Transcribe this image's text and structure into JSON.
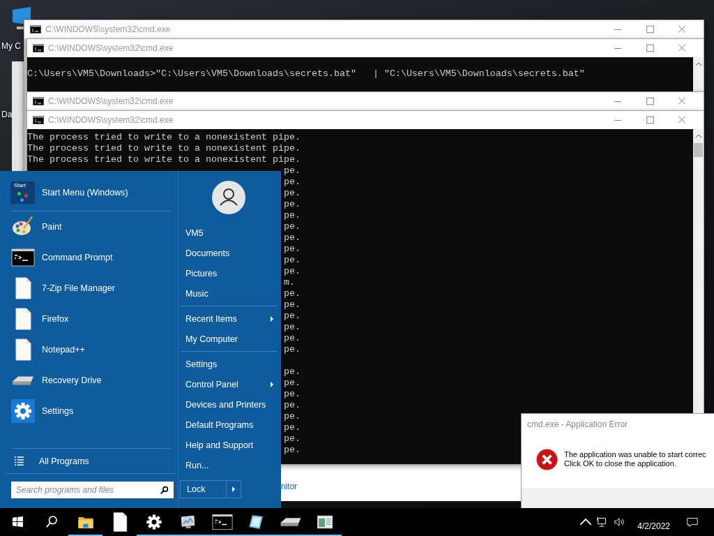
{
  "desktop": {
    "icons": [
      {
        "label": "My C"
      },
      {
        "label": "Da"
      }
    ]
  },
  "windows": [
    {
      "title": "C:\\WINDOWS\\system32\\cmd.exe",
      "active": false
    },
    {
      "title": "C:\\WINDOWS\\system32\\cmd.exe",
      "active": false,
      "console": [
        {
          "kind": "full",
          "text": "C:\\Users\\VM5\\Downloads>\"C:\\Users\\VM5\\Downloads\\secrets.bat\"   | \"C:\\Users\\VM5\\Downloads\\secrets.bat\""
        }
      ]
    },
    {
      "title": "C:\\WINDOWS\\system32\\cmd.exe",
      "active": false
    },
    {
      "title": "C:\\WINDOWS\\system32\\cmd.exe",
      "active": false,
      "console": [
        {
          "kind": "full",
          "text": "The process tried to write to a nonexistent pipe."
        },
        {
          "kind": "full",
          "text": "The process tried to write to a nonexistent pipe."
        },
        {
          "kind": "full",
          "text": "The process tried to write to a nonexistent pipe."
        },
        {
          "kind": "tail",
          "text": "pe."
        },
        {
          "kind": "tail",
          "text": "pe."
        },
        {
          "kind": "tail",
          "text": "pe."
        },
        {
          "kind": "tail",
          "text": "pe."
        },
        {
          "kind": "tail",
          "text": "pe."
        },
        {
          "kind": "tail",
          "text": "pe."
        },
        {
          "kind": "tail",
          "text": "pe."
        },
        {
          "kind": "tail",
          "text": "pe."
        },
        {
          "kind": "tail",
          "text": "pe."
        },
        {
          "kind": "tail",
          "text": "pe."
        },
        {
          "kind": "tail",
          "text": "m."
        },
        {
          "kind": "tail",
          "text": "pe."
        },
        {
          "kind": "tail",
          "text": "pe."
        },
        {
          "kind": "tail",
          "text": "pe."
        },
        {
          "kind": "tail",
          "text": "pe."
        },
        {
          "kind": "tail",
          "text": "pe."
        },
        {
          "kind": "tail",
          "text": "pe."
        },
        {
          "kind": "blank"
        },
        {
          "kind": "tail",
          "text": "pe."
        },
        {
          "kind": "tail",
          "text": "pe."
        },
        {
          "kind": "tail",
          "text": "pe."
        },
        {
          "kind": "tail",
          "text": "pe."
        },
        {
          "kind": "tail",
          "text": "pe."
        },
        {
          "kind": "tail",
          "text": "pe."
        },
        {
          "kind": "tail",
          "text": "pe."
        },
        {
          "kind": "tail",
          "text": "pe."
        }
      ]
    }
  ],
  "background_window": {
    "link": "nitor"
  },
  "start_menu": {
    "header": {
      "logo_text": "Start",
      "label": "Start Menu (Windows)"
    },
    "programs": [
      {
        "label": "Paint",
        "kind": "paint"
      },
      {
        "label": "Command Prompt",
        "kind": "terminal"
      },
      {
        "label": "7-Zip File Manager",
        "kind": "file"
      },
      {
        "label": "Firefox",
        "kind": "file"
      },
      {
        "label": "Notepad++",
        "kind": "file"
      },
      {
        "label": "Recovery Drive",
        "kind": "drive"
      },
      {
        "label": "Settings",
        "kind": "gear"
      }
    ],
    "all_programs": "All Programs",
    "search": {
      "placeholder": "Search programs and files"
    },
    "places": [
      {
        "items": [
          {
            "label": "VM5",
            "submenu": false
          },
          {
            "label": "Documents",
            "submenu": false
          },
          {
            "label": "Pictures",
            "submenu": false
          },
          {
            "label": "Music",
            "submenu": false
          }
        ]
      },
      {
        "items": [
          {
            "label": "Recent Items",
            "submenu": true
          },
          {
            "label": "My Computer",
            "submenu": false
          }
        ]
      },
      {
        "items": [
          {
            "label": "Settings",
            "submenu": false
          },
          {
            "label": "Control Panel",
            "submenu": true
          },
          {
            "label": "Devices and Printers",
            "submenu": false
          },
          {
            "label": "Default Programs",
            "submenu": false
          },
          {
            "label": "Help and Support",
            "submenu": false
          },
          {
            "label": "Run...",
            "submenu": false
          }
        ]
      }
    ],
    "lock": "Lock"
  },
  "error_dialog": {
    "title": "cmd.exe - Application Error",
    "message": [
      "The application was unable to start correc",
      "Click OK to close the application."
    ]
  },
  "taskbar": {
    "items": [
      {
        "kind": "start",
        "running": false
      },
      {
        "kind": "search",
        "running": false
      },
      {
        "kind": "folder",
        "running": true
      },
      {
        "kind": "file",
        "running": false
      },
      {
        "kind": "gear",
        "running": true
      },
      {
        "kind": "monitor",
        "running": true
      },
      {
        "kind": "terminal",
        "running": true
      },
      {
        "kind": "notepad",
        "running": true
      },
      {
        "kind": "drive",
        "running": true
      },
      {
        "kind": "window",
        "running": true
      }
    ],
    "date": "4/2/2022"
  }
}
